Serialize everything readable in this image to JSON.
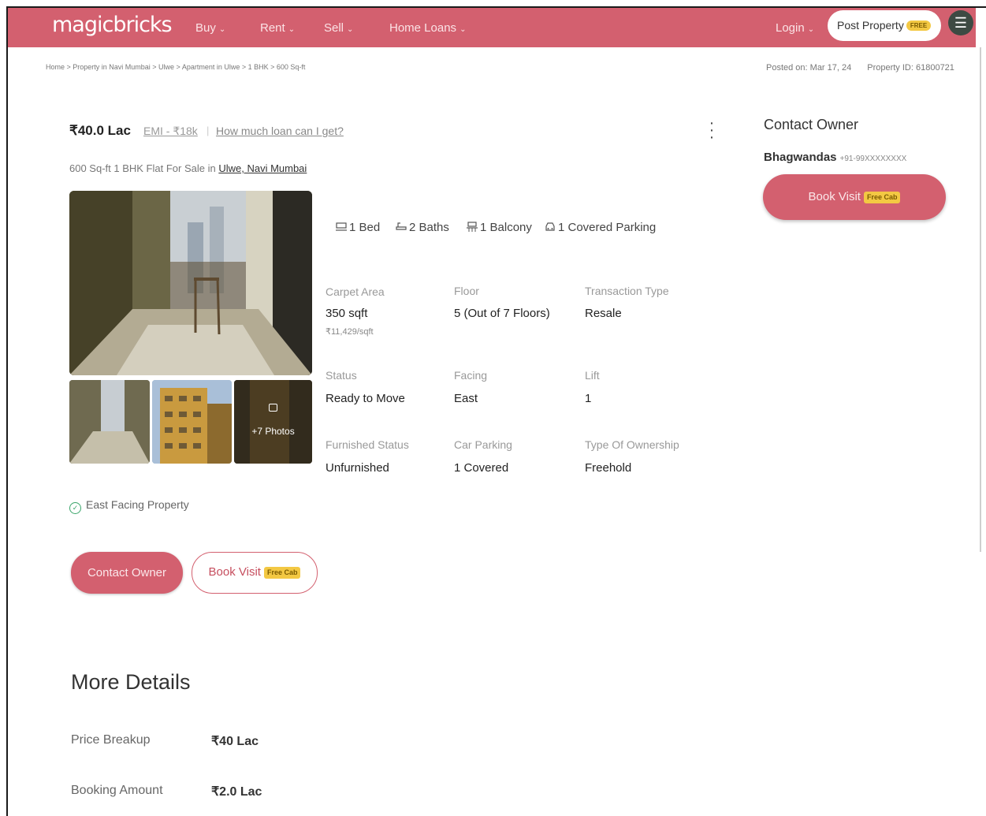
{
  "header": {
    "logo": "magicbricks",
    "nav": [
      {
        "label": "Buy"
      },
      {
        "label": "Rent"
      },
      {
        "label": "Sell"
      },
      {
        "label": "Home Loans"
      }
    ],
    "login": "Login",
    "post_property": "Post Property",
    "post_property_badge": "FREE",
    "brand_color": "#d3606f"
  },
  "breadcrumb": "Home > Property in Navi Mumbai > Ulwe > Apartment in Ulwe > 1 BHK > 600 Sq-ft",
  "posted_on": "Posted on: Mar 17, 24",
  "property_id": "Property ID: 61800721",
  "listing": {
    "price": "₹40.0 Lac",
    "emi": "EMI - ₹18k",
    "loan_link": "How much loan can I get?",
    "subtitle_prefix": "600 Sq-ft 1 BHK Flat For Sale in",
    "location": "Ulwe, Navi Mumbai",
    "photos_more": "+7 Photos",
    "amenities": [
      {
        "icon": "bed-icon",
        "label": "1 Bed"
      },
      {
        "icon": "bath-icon",
        "label": "2 Baths"
      },
      {
        "icon": "balcony-icon",
        "label": "1 Balcony"
      },
      {
        "icon": "car-icon",
        "label": "1 Covered Parking"
      }
    ],
    "details": [
      {
        "label": "Carpet Area",
        "value": "350 sqft",
        "sub": "₹11,429/sqft"
      },
      {
        "label": "Floor",
        "value": "5 (Out of 7 Floors)"
      },
      {
        "label": "Transaction Type",
        "value": "Resale"
      },
      {
        "label": "Status",
        "value": "Ready to Move"
      },
      {
        "label": "Facing",
        "value": "East"
      },
      {
        "label": "Lift",
        "value": "1"
      },
      {
        "label": "Furnished Status",
        "value": "Unfurnished"
      },
      {
        "label": "Car Parking",
        "value": "1 Covered"
      },
      {
        "label": "Type Of Ownership",
        "value": "Freehold"
      }
    ],
    "highlight": "East Facing Property",
    "contact_button": "Contact Owner",
    "book_button": "Book Visit",
    "free_cab": "Free Cab"
  },
  "more_details": {
    "title": "More Details",
    "rows": [
      {
        "label": "Price Breakup",
        "value": "₹40 Lac"
      },
      {
        "label": "Booking Amount",
        "value": "₹2.0 Lac"
      }
    ]
  },
  "contact_panel": {
    "title": "Contact Owner",
    "owner_name": "Bhagwandas",
    "owner_phone": "+91-99XXXXXXXX",
    "book_button": "Book Visit",
    "free_cab": "Free Cab"
  }
}
